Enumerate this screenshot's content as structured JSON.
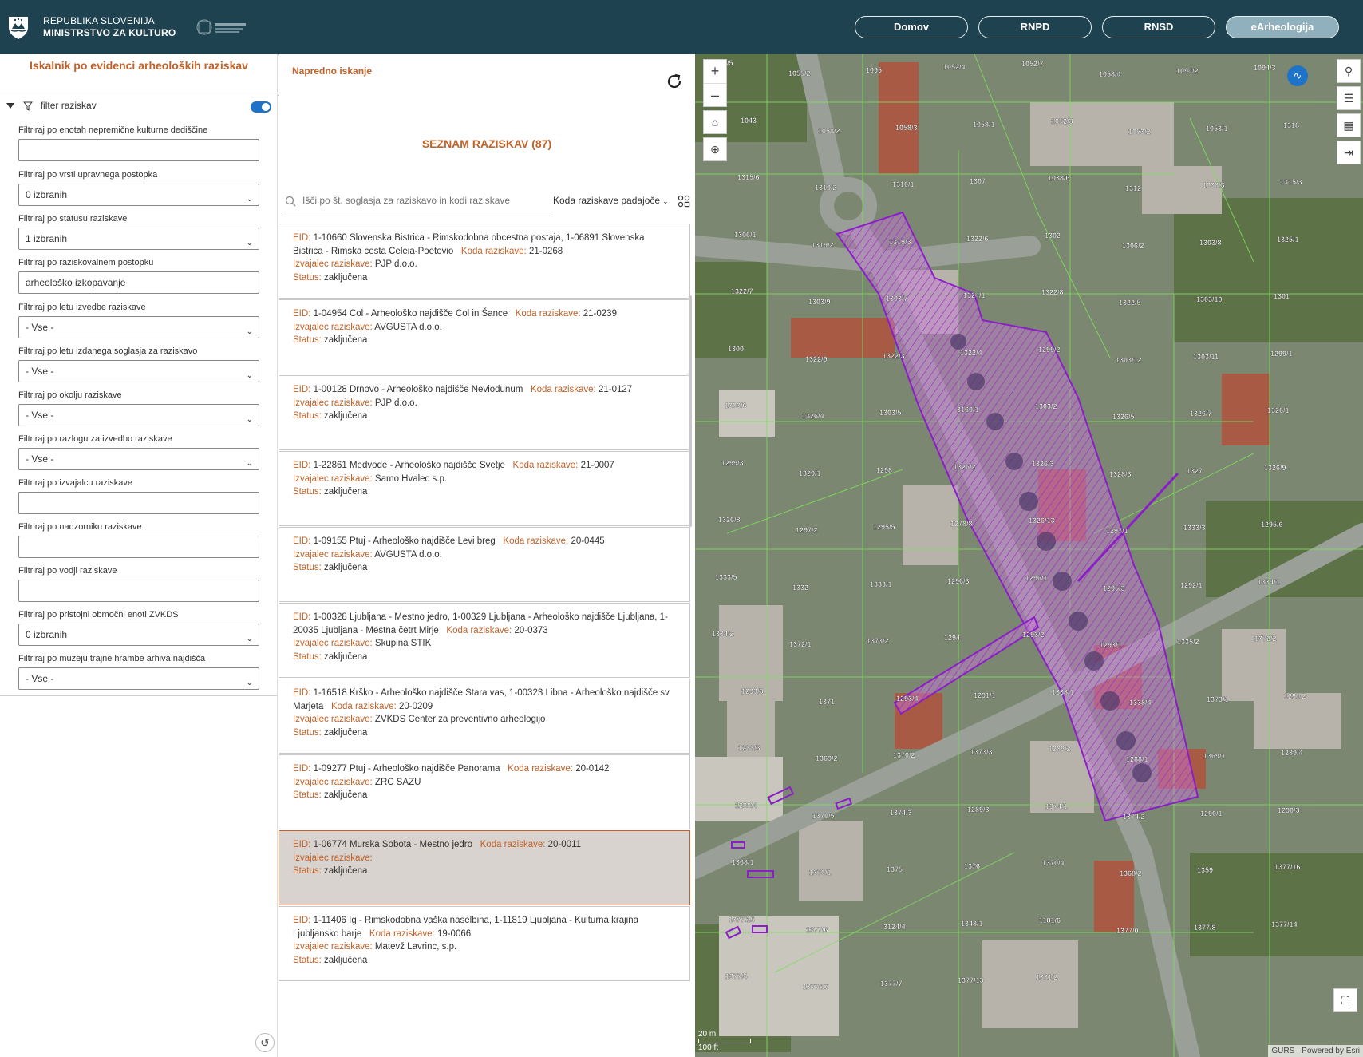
{
  "header": {
    "org_line1": "REPUBLIKA SLOVENIJA",
    "org_line2": "MINISTRSTVO ZA KULTURO",
    "nav": [
      {
        "label": "Domov"
      },
      {
        "label": "RNPD"
      },
      {
        "label": "RNSD"
      },
      {
        "label": "eArheologija",
        "active": true
      }
    ]
  },
  "left": {
    "title": "Iskalnik po evidenci arheoloških raziskav",
    "filter_header": "filter raziskav",
    "filter_enabled": true,
    "filters": [
      {
        "label": "Filtriraj po enotah nepremične kulturne dediščine",
        "value": "",
        "type": "text"
      },
      {
        "label": "Filtriraj po vrsti upravnega postopka",
        "value": "0 izbranih",
        "type": "select"
      },
      {
        "label": "Filtriraj po statusu raziskave",
        "value": "1 izbranih",
        "type": "select"
      },
      {
        "label": "Filtriraj po raziskovalnem postopku",
        "value": "arheološko izkopavanje",
        "type": "text"
      },
      {
        "label": "Filtriraj po letu izvedbe raziskave",
        "value": "- Vse -",
        "type": "select"
      },
      {
        "label": "Filtriraj po letu izdanega soglasja za raziskavo",
        "value": "- Vse -",
        "type": "select"
      },
      {
        "label": "Filtriraj po okolju raziskave",
        "value": "- Vse -",
        "type": "select"
      },
      {
        "label": "Filtriraj po razlogu za izvedbo raziskave",
        "value": "- Vse -",
        "type": "select"
      },
      {
        "label": "Filtriraj po izvajalcu raziskave",
        "value": "",
        "type": "text"
      },
      {
        "label": "Filtriraj po nadzorniku raziskave",
        "value": "",
        "type": "text"
      },
      {
        "label": "Filtriraj po vodji raziskave",
        "value": "",
        "type": "text"
      },
      {
        "label": "Filtriraj po pristojni območni enoti ZVKDS",
        "value": "0 izbranih",
        "type": "select"
      },
      {
        "label": "Filtriraj po muzeju trajne hrambe arhiva najdišča",
        "value": "- Vse -",
        "type": "select"
      }
    ]
  },
  "middle": {
    "advanced": "Napredno iskanje",
    "list_title": "SEZNAM RAZISKAV (87)",
    "search_placeholder": "Išči po št. soglasja za raziskavo in kodi raziskave",
    "sort_label": "Koda raziskave padajoče",
    "labels": {
      "eid": "EID:",
      "koda": "Koda raziskave:",
      "izvajalec": "Izvajalec raziskave:",
      "status": "Status:"
    },
    "items": [
      {
        "eid": "1-10660 Slovenska Bistrica - Rimskodobna obcestna postaja, 1-06891 Slovenska Bistrica - Rimska cesta Celeia-Poetovio",
        "koda": "21-0268",
        "izvajalec": "PJP d.o.o.",
        "status": "zaključena"
      },
      {
        "eid": "1-04954 Col - Arheološko najdišče Col in Šance",
        "koda": "21-0239",
        "izvajalec": "AVGUSTA d.o.o.",
        "status": "zaključena"
      },
      {
        "eid": "1-00128 Drnovo - Arheološko najdišče Neviodunum",
        "koda": "21-0127",
        "izvajalec": "PJP d.o.o.",
        "status": "zaključena"
      },
      {
        "eid": "1-22861 Medvode - Arheološko najdišče Svetje",
        "koda": "21-0007",
        "izvajalec": "Samo Hvalec s.p.",
        "status": "zaključena"
      },
      {
        "eid": "1-09155 Ptuj - Arheološko najdišče Levi breg",
        "koda": "20-0445",
        "izvajalec": "AVGUSTA d.o.o.",
        "status": "zaključena"
      },
      {
        "eid": "1-00328 Ljubljana - Mestno jedro, 1-00329 Ljubljana - Arheološko najdišče Ljubljana, 1-20035 Ljubljana - Mestna četrt Mirje",
        "koda": "20-0373",
        "izvajalec": "Skupina STIK",
        "status": "zaključena"
      },
      {
        "eid": "1-16518 Krško - Arheološko najdišče Stara vas, 1-00323 Libna - Arheološko najdišče sv. Marjeta",
        "koda": "20-0209",
        "izvajalec": "ZVKDS Center za preventivno arheologijo",
        "status": "zaključena"
      },
      {
        "eid": "1-09277 Ptuj - Arheološko najdišče Panorama",
        "koda": "20-0142",
        "izvajalec": "ZRC SAZU",
        "status": "zaključena"
      },
      {
        "eid": "1-06774 Murska Sobota - Mestno jedro",
        "koda": "20-0011",
        "izvajalec": "",
        "status": "zaključena",
        "selected": true
      },
      {
        "eid": "1-11406 Ig - Rimskodobna vaška naselbina, 1-11819 Ljubljana - Kulturna krajina Ljubljansko barje",
        "koda": "19-0066",
        "izvajalec": "Matevž Lavrinc, s.p.",
        "status": "zaključena"
      }
    ]
  },
  "map": {
    "scale_m": "20 m",
    "scale_ft": "100 ft",
    "attribution": "GURS · Powered by Esri",
    "parcel_labels": [
      "1052/5",
      "1055/2",
      "1095",
      "1052/4",
      "1052/7",
      "1058/4",
      "1094/2",
      "1094/3",
      "1043",
      "1058/2",
      "1058/3",
      "1058/1",
      "1052/3",
      "1053/2",
      "1053/1",
      "1318",
      "1315/6",
      "1310/2",
      "1310/1",
      "1307",
      "1038/6",
      "1312",
      "1038/3",
      "1315/3",
      "1306/1",
      "1319/2",
      "1319/3",
      "1322/6",
      "1302",
      "1306/2",
      "1303/8",
      "1325/1",
      "1322/7",
      "1303/9",
      "1303/7",
      "1324/1",
      "1322/8",
      "1322/5",
      "1303/10",
      "1301",
      "1300",
      "1322/9",
      "1322/3",
      "1322/4",
      "1299/2",
      "1303/12",
      "1303/11",
      "1299/1",
      "1303/6",
      "1326/4",
      "1303/5",
      "3160/1",
      "1303/2",
      "1326/5",
      "1326/7",
      "1326/1",
      "1299/3",
      "1329/1",
      "1298",
      "1326/2",
      "1326/3",
      "1328/3",
      "1327",
      "1326/9",
      "1326/8",
      "1297/2",
      "1295/5",
      "1278/8",
      "1326/13",
      "1297/1",
      "1333/3",
      "1295/6",
      "1333/5",
      "1332",
      "1333/1",
      "1296/3",
      "1296/1",
      "1295/3",
      "1292/1",
      "1334/1",
      "1334/2",
      "1372/1",
      "1373/2",
      "1294",
      "1293/2",
      "1293/1",
      "1335/2",
      "1372/2",
      "1293/3",
      "1371",
      "1293/4",
      "1291/1",
      "1338/1",
      "1338/4",
      "1373/1",
      "1291/2",
      "1288/3",
      "1369/2",
      "1370/2",
      "1373/3",
      "1289/2",
      "1288/1",
      "1369/1",
      "1289/4",
      "1288/4",
      "1370/5",
      "1374/3",
      "1289/3",
      "1374/1",
      "1374/2",
      "1290/1",
      "1290/3",
      "1368/1",
      "1370/1",
      "1375",
      "1376",
      "1370/4",
      "1368/2",
      "1359",
      "1377/16",
      "1377/15",
      "1377/6",
      "3124/4",
      "1348/1",
      "1181/6",
      "1377/0",
      "1377/8",
      "1377/14",
      "1377/4",
      "1377/17",
      "1377/7",
      "1377/13",
      "1381/2"
    ]
  }
}
